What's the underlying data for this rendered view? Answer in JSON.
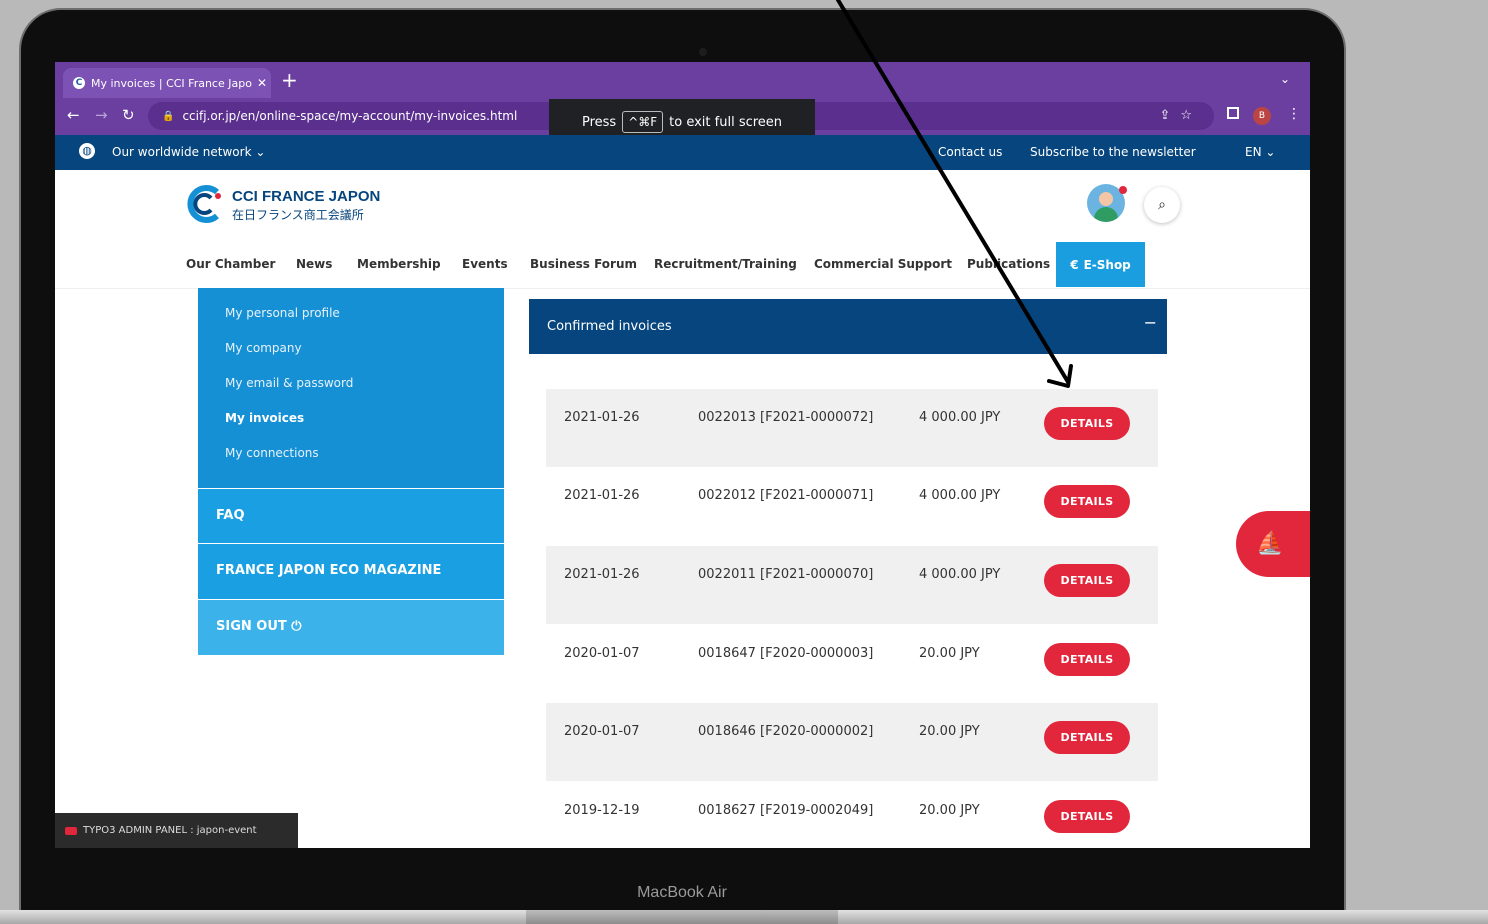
{
  "browser": {
    "tab_title": "My invoices | CCI France Japo",
    "url": "ccifj.or.jp/en/online-space/my-account/my-invoices.html",
    "profile_initial": "B",
    "fullscreen_press": "Press",
    "fullscreen_keys": "^⌘F",
    "fullscreen_rest": "to exit full screen"
  },
  "topbar": {
    "network": "Our worldwide network",
    "contact": "Contact us",
    "subscribe": "Subscribe to the newsletter",
    "lang": "EN"
  },
  "brand": {
    "name": "CCI FRANCE JAPON",
    "name_jp": "在日フランス商工会議所"
  },
  "nav": {
    "items": [
      "Our Chamber",
      "News",
      "Membership",
      "Events",
      "Business Forum",
      "Recruitment/Training",
      "Commercial Support",
      "Publications"
    ],
    "eshop": "E-Shop"
  },
  "sidebar": {
    "links": [
      "My personal profile",
      "My company",
      "My email & password",
      "My invoices",
      "My connections"
    ],
    "faq": "FAQ",
    "magazine": "FRANCE JAPON ECO MAGAZINE",
    "signout": "SIGN OUT"
  },
  "invoices": {
    "title": "Confirmed invoices",
    "toggle": "−",
    "button_label": "DETAILS",
    "rows": [
      {
        "date": "2021-01-26",
        "ref": "0022013 [F2021-0000072]",
        "amount": "4 000.00 JPY"
      },
      {
        "date": "2021-01-26",
        "ref": "0022012 [F2021-0000071]",
        "amount": "4 000.00 JPY"
      },
      {
        "date": "2021-01-26",
        "ref": "0022011 [F2021-0000070]",
        "amount": "4 000.00 JPY"
      },
      {
        "date": "2020-01-07",
        "ref": "0018647 [F2020-0000003]",
        "amount": "20.00 JPY"
      },
      {
        "date": "2020-01-07",
        "ref": "0018646 [F2020-0000002]",
        "amount": "20.00 JPY"
      },
      {
        "date": "2019-12-19",
        "ref": "0018627 [F2019-0002049]",
        "amount": "20.00 JPY"
      }
    ]
  },
  "admin_panel": "TYPO3 ADMIN PANEL : japon-event",
  "device_label": "MacBook Air",
  "colors": {
    "brand_blue": "#07457e",
    "accent_red": "#e2263b",
    "sidebar_blue": "#1690d4",
    "chrome_purple": "#6a3fa0"
  }
}
